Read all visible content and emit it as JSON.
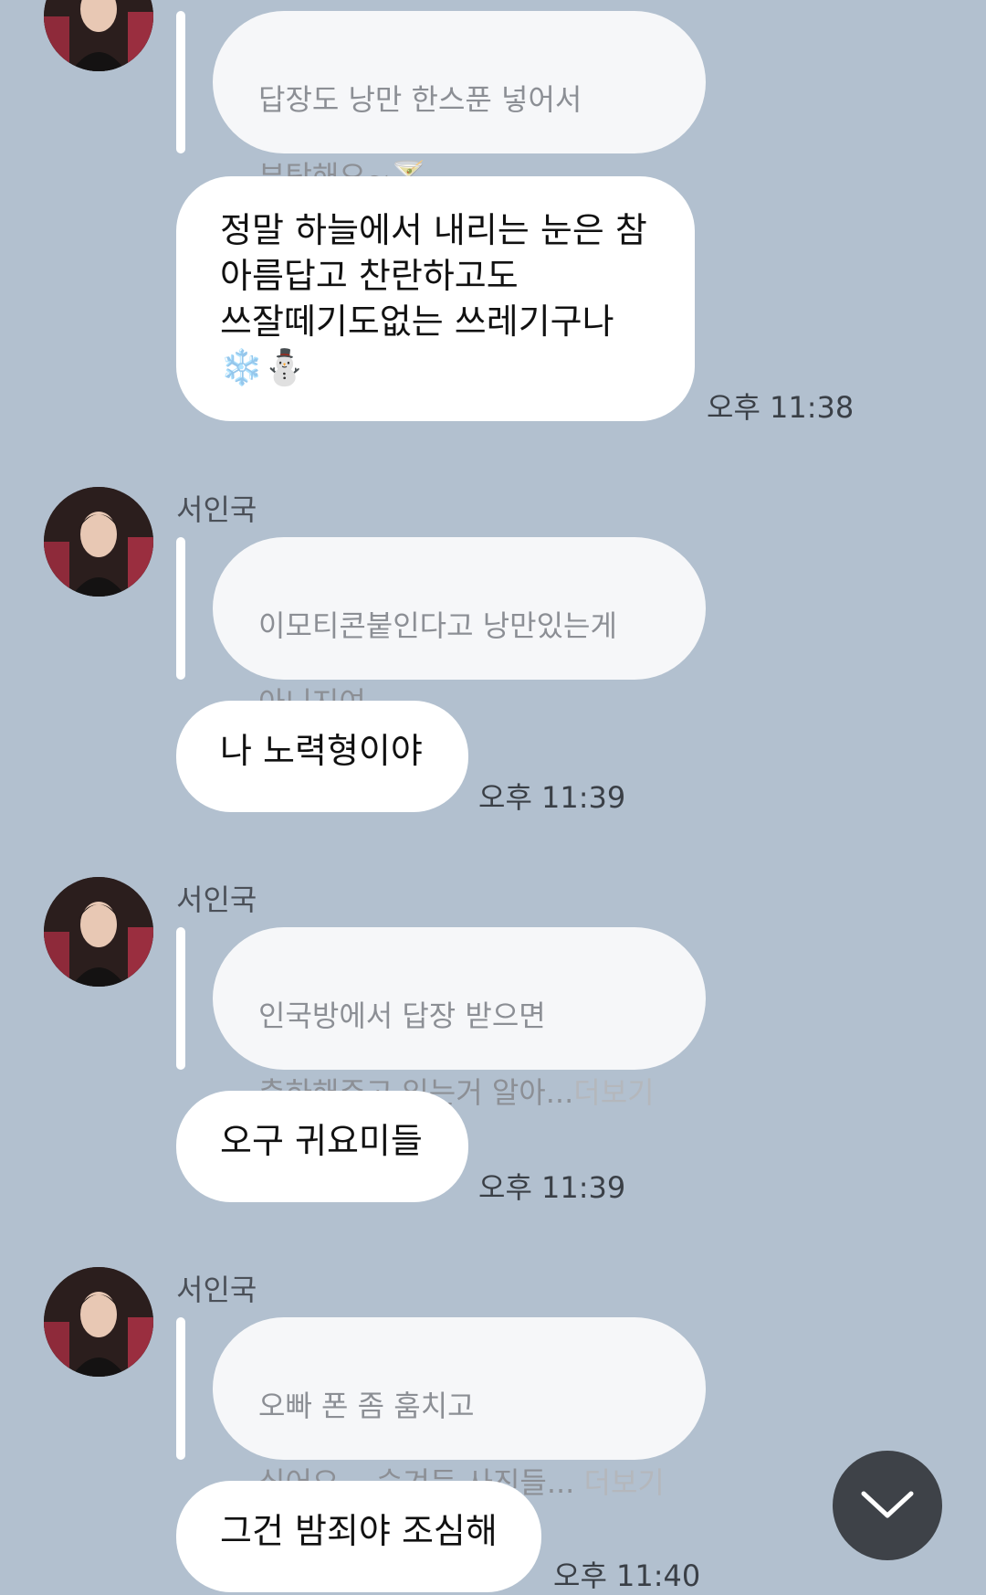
{
  "messages": [
    {
      "sender": "",
      "quote_lines": [
        "답장도 낭만 한스푼 넣어서",
        "부탁해요~🍸"
      ],
      "quote_more": "",
      "reply": "정말 하늘에서 내리는 눈은 참\n아름답고 찬란하고도\n쓰잘떼기도없는 쓰레기구나\n❄️⛄",
      "time": "오후 11:38"
    },
    {
      "sender": "서인국",
      "quote_lines": [
        "이모티콘붙인다고 낭만있는게",
        "아니지여"
      ],
      "quote_more": "",
      "reply": "나 노력형이야",
      "time": "오후 11:39"
    },
    {
      "sender": "서인국",
      "quote_lines": [
        "인국방에서 답장 받으면",
        "축하해주고 있는거 알아..."
      ],
      "quote_more": "더보기",
      "reply": "오구 귀요미들",
      "time": "오후 11:39"
    },
    {
      "sender": "서인국",
      "quote_lines": [
        "오빠 폰 좀 훔치고",
        "싶어요... 숨겨둔 사진들... "
      ],
      "quote_more": "더보기",
      "reply": "그건 밤죄야 조심해",
      "time": "오후 11:40"
    }
  ],
  "scroll_button": {
    "icon": "chevron-down-icon"
  },
  "colors": {
    "background": "#b2c0cf",
    "bubble": "#ffffff",
    "quote_bubble": "#f6f7f9",
    "scroll_button": "#3e4248"
  }
}
